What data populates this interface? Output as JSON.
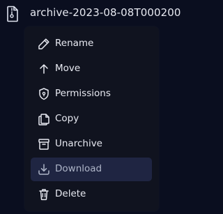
{
  "file": {
    "name": "archive-2023-08-08T000200"
  },
  "menu": {
    "items": [
      {
        "label": "Rename",
        "icon": "pencil-icon"
      },
      {
        "label": "Move",
        "icon": "arrow-up-icon"
      },
      {
        "label": "Permissions",
        "icon": "shield-icon"
      },
      {
        "label": "Copy",
        "icon": "copy-icon"
      },
      {
        "label": "Unarchive",
        "icon": "unarchive-icon"
      },
      {
        "label": "Download",
        "icon": "download-icon"
      },
      {
        "label": "Delete",
        "icon": "trash-icon"
      }
    ],
    "active_item": "Download"
  },
  "colors": {
    "background": "#0a0e1f",
    "menu_background": "#10131f",
    "active_background": "#1f2542",
    "text": "#e8eaf2",
    "muted_text": "#aeb5c8"
  }
}
